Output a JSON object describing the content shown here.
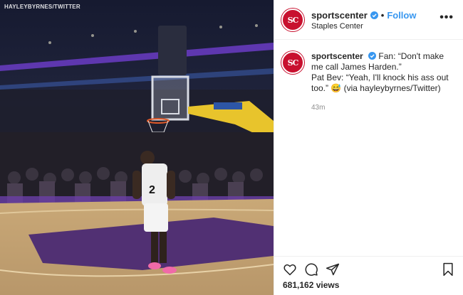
{
  "media": {
    "watermark": "HAYLEYBYRNES/TWITTER",
    "jersey_number": "2"
  },
  "header": {
    "username": "sportscenter",
    "follow_label": "Follow",
    "separator": "•",
    "location": "Staples Center",
    "more_label": "•••",
    "avatar_text": "SC"
  },
  "caption": {
    "username": "sportscenter",
    "line1": "Fan: “Don't make me call James Harden.”",
    "line2": "Pat Bev: “Yeah, I'll knock his ass out too.” 😅 (via hayleybyrnes/Twitter)",
    "time": "43m"
  },
  "actions": {
    "icons": [
      "heart-icon",
      "comment-icon",
      "share-icon",
      "bookmark-icon"
    ]
  },
  "stats": {
    "views": "681,162 views"
  },
  "colors": {
    "brand_red": "#c8102e",
    "link_blue": "#3897f0",
    "verified_blue": "#3897f0",
    "court_purple": "#4b2a73",
    "court_wood": "#d3b488"
  }
}
